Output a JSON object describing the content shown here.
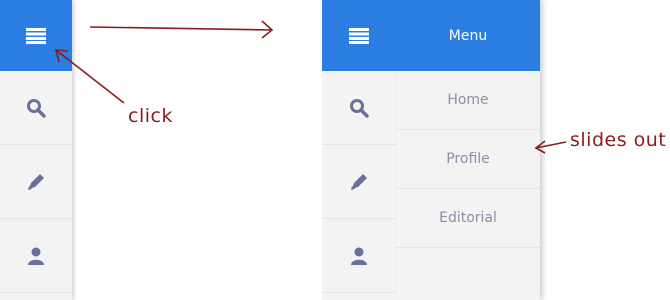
{
  "before": {
    "rail_items": [
      {
        "icon": "hamburger-menu-icon"
      },
      {
        "icon": "search-icon"
      },
      {
        "icon": "pencil-icon"
      },
      {
        "icon": "user-icon"
      }
    ]
  },
  "after": {
    "rail_items": [
      {
        "icon": "hamburger-menu-icon"
      },
      {
        "icon": "search-icon"
      },
      {
        "icon": "pencil-icon"
      },
      {
        "icon": "user-icon"
      }
    ],
    "panel": {
      "title": "Menu",
      "items": [
        "Home",
        "Profile",
        "Editorial"
      ]
    }
  },
  "annotations": {
    "click_label": "click",
    "slide_label": "slides out"
  },
  "colors": {
    "accent": "#2b7de1",
    "annotation": "#8b1c1c",
    "icon": "#6a6f9c"
  }
}
